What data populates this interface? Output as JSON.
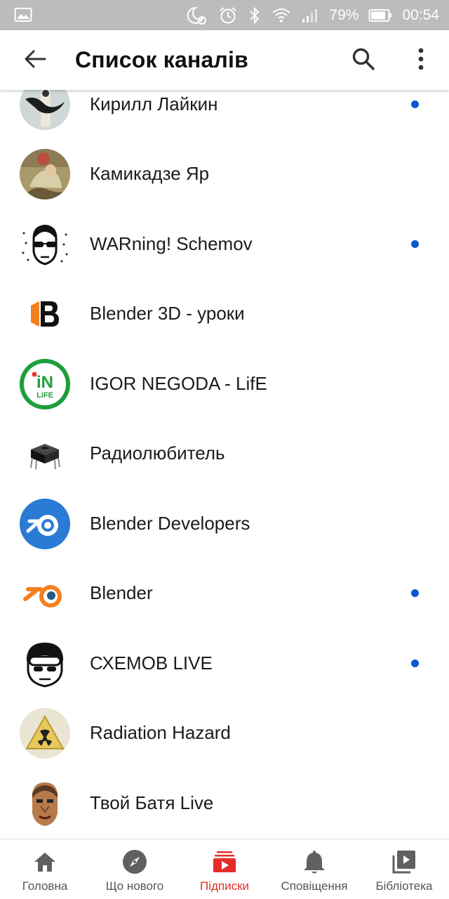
{
  "status_bar": {
    "battery": "79%",
    "time": "00:54",
    "icons": [
      "image-icon",
      "night-mode-icon",
      "alarm-icon",
      "bluetooth-icon",
      "wifi-icon",
      "signal-icon",
      "battery-icon"
    ]
  },
  "header": {
    "title": "Список каналів",
    "back_icon": "arrow-left-icon",
    "search_icon": "search-icon",
    "more_icon": "more-vertical-icon"
  },
  "channels": [
    {
      "name": "Кирилл Лайкин",
      "new_content": true
    },
    {
      "name": "Камикадзе Яр",
      "new_content": false
    },
    {
      "name": "WARning! Schemov",
      "new_content": true
    },
    {
      "name": "Blender 3D - уроки",
      "new_content": false
    },
    {
      "name": "IGOR NEGODA - LifE",
      "new_content": false
    },
    {
      "name": "Радиолюбитель",
      "new_content": false
    },
    {
      "name": "Blender Developers",
      "new_content": false
    },
    {
      "name": "Blender",
      "new_content": true
    },
    {
      "name": "СХЕМОВ LIVE",
      "new_content": true
    },
    {
      "name": "Radiation Hazard",
      "new_content": false
    },
    {
      "name": "Твой Батя Live",
      "new_content": false
    }
  ],
  "nav": {
    "items": [
      {
        "label": "Головна",
        "icon": "home-icon",
        "active": false
      },
      {
        "label": "Що нового",
        "icon": "compass-icon",
        "active": false
      },
      {
        "label": "Підписки",
        "icon": "subscriptions-icon",
        "active": true
      },
      {
        "label": "Сповіщення",
        "icon": "bell-icon",
        "active": false
      },
      {
        "label": "Бібліотека",
        "icon": "library-icon",
        "active": false
      }
    ]
  },
  "colors": {
    "accent": "#e52d27",
    "new_dot": "#0b57d0",
    "status_bar": "#bcbcbc",
    "icon_gray": "#606060"
  }
}
